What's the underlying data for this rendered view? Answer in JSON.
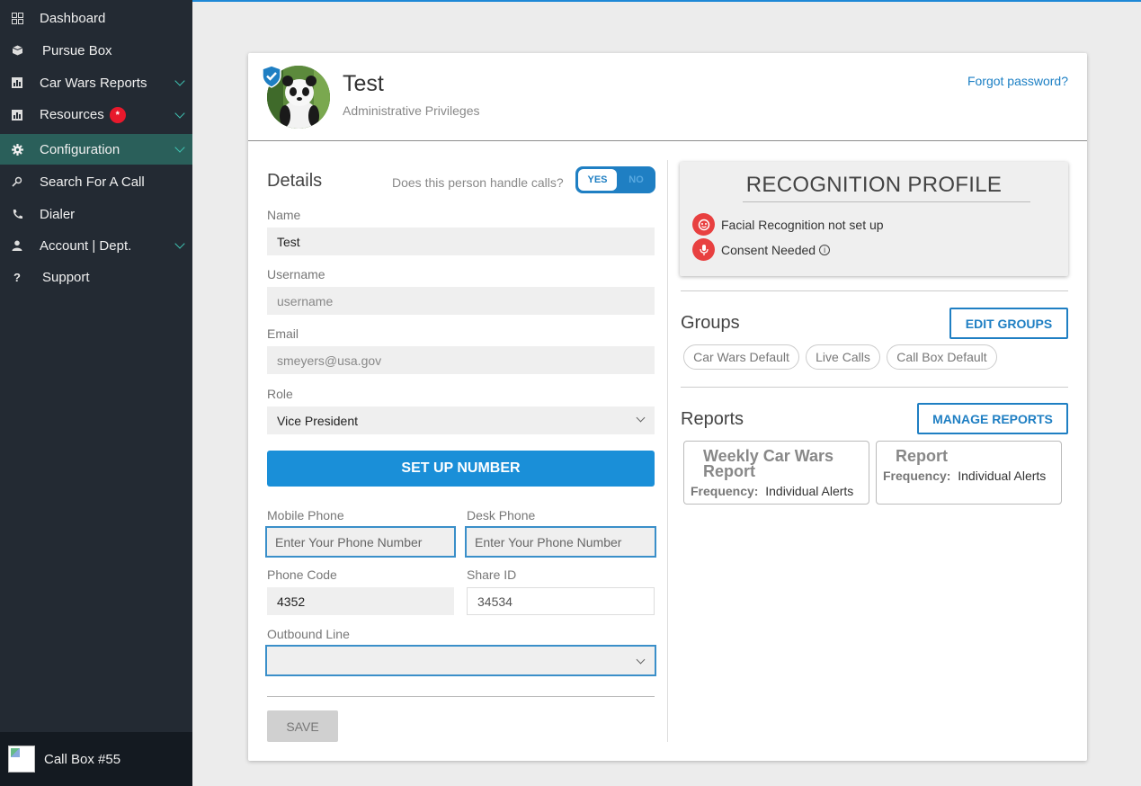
{
  "sidebar": {
    "items": [
      {
        "label": "Dashboard",
        "icon": "grid-icon"
      },
      {
        "label": "Pursue Box",
        "icon": "box-icon"
      },
      {
        "label": "Car Wars Reports",
        "icon": "chart-icon"
      },
      {
        "label": "Resources",
        "icon": "chart-icon",
        "badge": "*"
      },
      {
        "label": "Configuration",
        "icon": "gear-icon"
      },
      {
        "label": "Search For A Call",
        "icon": "search-icon"
      },
      {
        "label": "Dialer",
        "icon": "phone-icon"
      },
      {
        "label": "Account | Dept.",
        "icon": "person-icon"
      },
      {
        "label": "Support",
        "icon": "question-icon"
      }
    ],
    "callbox_label": "Call Box #55"
  },
  "profile": {
    "name": "Test",
    "role": "Administrative Privileges",
    "forgot_password": "Forgot password?"
  },
  "details": {
    "title": "Details",
    "handle_calls_question": "Does this person handle calls?",
    "toggle_yes": "YES",
    "toggle_no": "NO",
    "name_label": "Name",
    "name_value": "Test",
    "username_label": "Username",
    "username_value": "username",
    "email_label": "Email",
    "email_value": "smeyers@usa.gov",
    "role_label": "Role",
    "role_value": "Vice President",
    "setup_button": "SET UP NUMBER",
    "mobile_label": "Mobile Phone",
    "mobile_placeholder": "Enter Your Phone Number",
    "desk_label": "Desk Phone",
    "desk_placeholder": "Enter Your Phone Number",
    "phone_code_label": "Phone Code",
    "phone_code_value": "4352",
    "share_id_label": "Share ID",
    "share_id_value": "34534",
    "outbound_label": "Outbound Line",
    "outbound_value": "",
    "save_button": "SAVE"
  },
  "recognition": {
    "title": "RECOGNITION PROFILE",
    "facial": "Facial Recognition not set up",
    "consent": "Consent Needed"
  },
  "groups": {
    "title": "Groups",
    "edit_button": "EDIT GROUPS",
    "chips": [
      "Car Wars Default",
      "Live Calls",
      "Call Box Default"
    ]
  },
  "reports": {
    "title": "Reports",
    "manage_button": "MANAGE REPORTS",
    "cards": [
      {
        "title_line1": "Weekly Car Wars",
        "title_line2": "Report",
        "freq_label": "Frequency:",
        "freq_value": "Individual Alerts"
      },
      {
        "title_line1": "Report",
        "title_line2": "",
        "freq_label": "Frequency:",
        "freq_value": "Individual Alerts"
      }
    ]
  },
  "colors": {
    "sidebar": "#232a33",
    "active": "#2a5f5a",
    "accent": "#1a8fd8",
    "alert": "#e84040"
  }
}
